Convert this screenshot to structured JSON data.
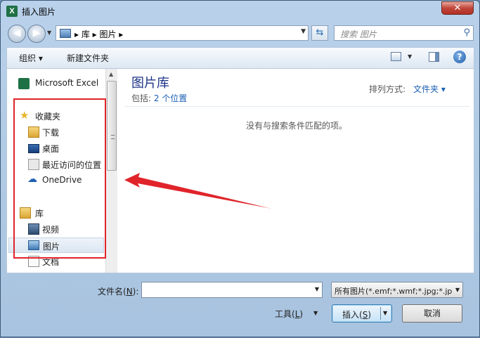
{
  "window": {
    "title": "插入图片",
    "app_icon_letter": "X",
    "close_glyph": "✕"
  },
  "navbar": {
    "address_path": "▸ 库 ▸ 图片 ▸",
    "search_placeholder": "搜索 图片"
  },
  "toolbar": {
    "organize_label": "组织 ▾",
    "new_folder_label": "新建文件夹",
    "help_glyph": "?"
  },
  "sidebar": {
    "items": [
      {
        "label": "Microsoft Excel",
        "icon": "excel-icon"
      },
      {
        "label": "收藏夹",
        "icon": "star-icon"
      },
      {
        "label": "下载",
        "icon": "download-folder-icon"
      },
      {
        "label": "桌面",
        "icon": "desktop-icon"
      },
      {
        "label": "最近访问的位置",
        "icon": "recent-places-icon"
      },
      {
        "label": "OneDrive",
        "icon": "cloud-icon"
      },
      {
        "label": "库",
        "icon": "library-icon"
      },
      {
        "label": "视频",
        "icon": "video-icon"
      },
      {
        "label": "图片",
        "icon": "pictures-icon",
        "selected": true
      },
      {
        "label": "文档",
        "icon": "documents-icon"
      }
    ]
  },
  "content": {
    "library_title": "图片库",
    "include_prefix": "包括: ",
    "include_link": "2 个位置",
    "arrange_label": "排列方式:",
    "arrange_value": "文件夹 ▾",
    "empty_message": "没有与搜索条件匹配的项。"
  },
  "footer": {
    "filename_label_pre": "文件名(",
    "filename_label_key": "N",
    "filename_label_post": "):",
    "filename_value": "",
    "filetype_value": "所有图片(*.emf;*.wmf;*.jpg;*.jp",
    "tools_label_pre": "工具(",
    "tools_label_key": "L",
    "tools_label_post": ")",
    "insert_label_pre": "插入(",
    "insert_label_key": "S",
    "insert_label_post": ")",
    "cancel_label": "取消"
  },
  "colors": {
    "annotation": "#e0242a",
    "link": "#1a5fb4",
    "library_title": "#1e3287"
  }
}
